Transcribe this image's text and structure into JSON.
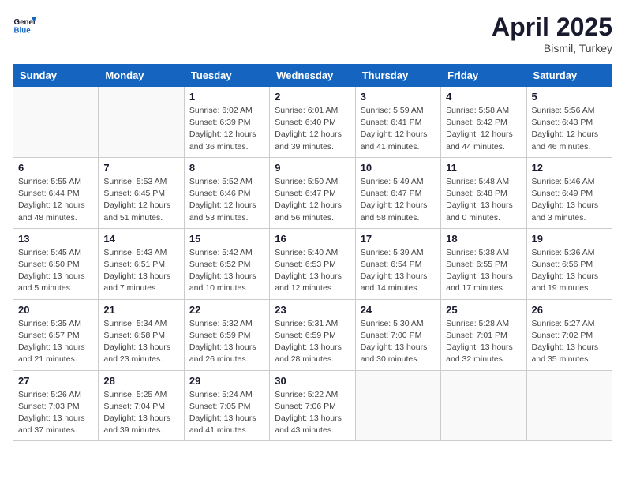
{
  "header": {
    "logo_line1": "General",
    "logo_line2": "Blue",
    "month": "April 2025",
    "location": "Bismil, Turkey"
  },
  "weekdays": [
    "Sunday",
    "Monday",
    "Tuesday",
    "Wednesday",
    "Thursday",
    "Friday",
    "Saturday"
  ],
  "weeks": [
    [
      {
        "day": "",
        "info": ""
      },
      {
        "day": "",
        "info": ""
      },
      {
        "day": "1",
        "info": "Sunrise: 6:02 AM\nSunset: 6:39 PM\nDaylight: 12 hours and 36 minutes."
      },
      {
        "day": "2",
        "info": "Sunrise: 6:01 AM\nSunset: 6:40 PM\nDaylight: 12 hours and 39 minutes."
      },
      {
        "day": "3",
        "info": "Sunrise: 5:59 AM\nSunset: 6:41 PM\nDaylight: 12 hours and 41 minutes."
      },
      {
        "day": "4",
        "info": "Sunrise: 5:58 AM\nSunset: 6:42 PM\nDaylight: 12 hours and 44 minutes."
      },
      {
        "day": "5",
        "info": "Sunrise: 5:56 AM\nSunset: 6:43 PM\nDaylight: 12 hours and 46 minutes."
      }
    ],
    [
      {
        "day": "6",
        "info": "Sunrise: 5:55 AM\nSunset: 6:44 PM\nDaylight: 12 hours and 48 minutes."
      },
      {
        "day": "7",
        "info": "Sunrise: 5:53 AM\nSunset: 6:45 PM\nDaylight: 12 hours and 51 minutes."
      },
      {
        "day": "8",
        "info": "Sunrise: 5:52 AM\nSunset: 6:46 PM\nDaylight: 12 hours and 53 minutes."
      },
      {
        "day": "9",
        "info": "Sunrise: 5:50 AM\nSunset: 6:47 PM\nDaylight: 12 hours and 56 minutes."
      },
      {
        "day": "10",
        "info": "Sunrise: 5:49 AM\nSunset: 6:47 PM\nDaylight: 12 hours and 58 minutes."
      },
      {
        "day": "11",
        "info": "Sunrise: 5:48 AM\nSunset: 6:48 PM\nDaylight: 13 hours and 0 minutes."
      },
      {
        "day": "12",
        "info": "Sunrise: 5:46 AM\nSunset: 6:49 PM\nDaylight: 13 hours and 3 minutes."
      }
    ],
    [
      {
        "day": "13",
        "info": "Sunrise: 5:45 AM\nSunset: 6:50 PM\nDaylight: 13 hours and 5 minutes."
      },
      {
        "day": "14",
        "info": "Sunrise: 5:43 AM\nSunset: 6:51 PM\nDaylight: 13 hours and 7 minutes."
      },
      {
        "day": "15",
        "info": "Sunrise: 5:42 AM\nSunset: 6:52 PM\nDaylight: 13 hours and 10 minutes."
      },
      {
        "day": "16",
        "info": "Sunrise: 5:40 AM\nSunset: 6:53 PM\nDaylight: 13 hours and 12 minutes."
      },
      {
        "day": "17",
        "info": "Sunrise: 5:39 AM\nSunset: 6:54 PM\nDaylight: 13 hours and 14 minutes."
      },
      {
        "day": "18",
        "info": "Sunrise: 5:38 AM\nSunset: 6:55 PM\nDaylight: 13 hours and 17 minutes."
      },
      {
        "day": "19",
        "info": "Sunrise: 5:36 AM\nSunset: 6:56 PM\nDaylight: 13 hours and 19 minutes."
      }
    ],
    [
      {
        "day": "20",
        "info": "Sunrise: 5:35 AM\nSunset: 6:57 PM\nDaylight: 13 hours and 21 minutes."
      },
      {
        "day": "21",
        "info": "Sunrise: 5:34 AM\nSunset: 6:58 PM\nDaylight: 13 hours and 23 minutes."
      },
      {
        "day": "22",
        "info": "Sunrise: 5:32 AM\nSunset: 6:59 PM\nDaylight: 13 hours and 26 minutes."
      },
      {
        "day": "23",
        "info": "Sunrise: 5:31 AM\nSunset: 6:59 PM\nDaylight: 13 hours and 28 minutes."
      },
      {
        "day": "24",
        "info": "Sunrise: 5:30 AM\nSunset: 7:00 PM\nDaylight: 13 hours and 30 minutes."
      },
      {
        "day": "25",
        "info": "Sunrise: 5:28 AM\nSunset: 7:01 PM\nDaylight: 13 hours and 32 minutes."
      },
      {
        "day": "26",
        "info": "Sunrise: 5:27 AM\nSunset: 7:02 PM\nDaylight: 13 hours and 35 minutes."
      }
    ],
    [
      {
        "day": "27",
        "info": "Sunrise: 5:26 AM\nSunset: 7:03 PM\nDaylight: 13 hours and 37 minutes."
      },
      {
        "day": "28",
        "info": "Sunrise: 5:25 AM\nSunset: 7:04 PM\nDaylight: 13 hours and 39 minutes."
      },
      {
        "day": "29",
        "info": "Sunrise: 5:24 AM\nSunset: 7:05 PM\nDaylight: 13 hours and 41 minutes."
      },
      {
        "day": "30",
        "info": "Sunrise: 5:22 AM\nSunset: 7:06 PM\nDaylight: 13 hours and 43 minutes."
      },
      {
        "day": "",
        "info": ""
      },
      {
        "day": "",
        "info": ""
      },
      {
        "day": "",
        "info": ""
      }
    ]
  ]
}
